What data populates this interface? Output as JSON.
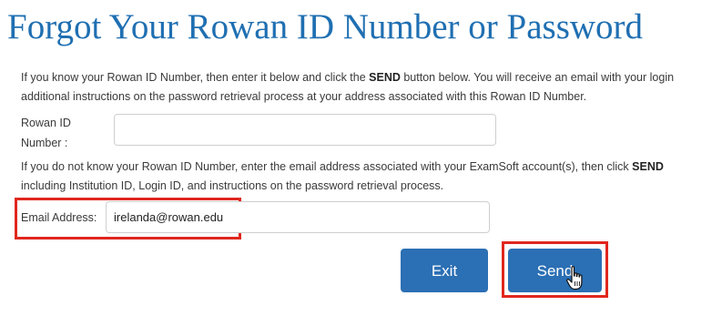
{
  "page": {
    "title": "Forgot Your Rowan ID Number or Password"
  },
  "instructions": {
    "id_known_line1_pre": "If you know your Rowan ID Number, then enter it below and click the ",
    "id_known_line1_bold": "SEND",
    "id_known_line1_post": " button below. You will receive an email with your login",
    "id_known_line2": "additional instructions on the password retrieval process at your address associated with this Rowan ID Number.",
    "id_unknown_line1_pre": "If you do not know your Rowan ID Number, enter the email address associated with your ExamSoft account(s), then click ",
    "id_unknown_line1_bold": "SEND",
    "id_unknown_line2": "including Institution ID, Login ID, and instructions on the password retrieval process."
  },
  "form": {
    "rowan_id": {
      "label_line1": "Rowan ID",
      "label_line2": "Number :",
      "value": ""
    },
    "email": {
      "label": "Email Address:",
      "value": "irelanda@rowan.edu"
    }
  },
  "buttons": {
    "exit_label": "Exit",
    "send_label": "Send"
  },
  "colors": {
    "title": "#1f6fb2",
    "button": "#2b6fb4",
    "highlight": "#e0271e"
  },
  "icons": {
    "cursor": "hand-pointer-icon"
  }
}
